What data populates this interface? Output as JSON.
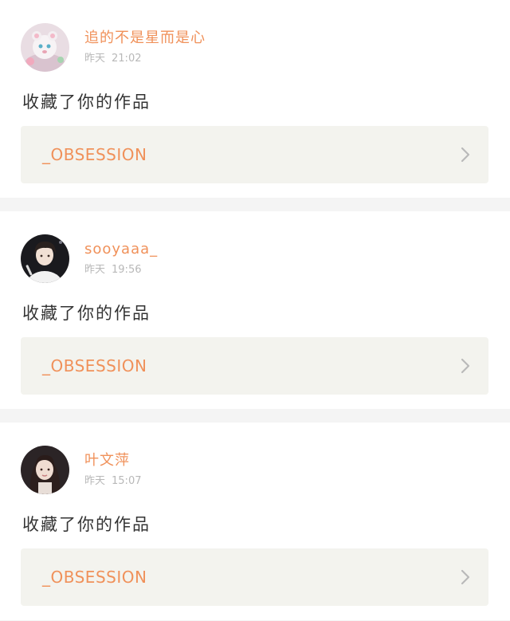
{
  "notifications": [
    {
      "username": "追的不是星而是心",
      "day": "昨天",
      "time": "21:02",
      "action": "收藏了你的作品",
      "work_title": "_OBSESSION",
      "avatar_icon": "plush-toy-avatar"
    },
    {
      "username": "sooyaaa_",
      "day": "昨天",
      "time": "19:56",
      "action": "收藏了你的作品",
      "work_title": "_OBSESSION",
      "avatar_icon": "singer-avatar"
    },
    {
      "username": "叶文萍",
      "day": "昨天",
      "time": "15:07",
      "action": "收藏了你的作品",
      "work_title": "_OBSESSION",
      "avatar_icon": "woman-portrait-avatar"
    }
  ],
  "colors": {
    "accent": "#f0915a",
    "link_background": "#f3f3ee",
    "timestamp": "#b8b8b8",
    "separator": "#f4f4f4"
  }
}
